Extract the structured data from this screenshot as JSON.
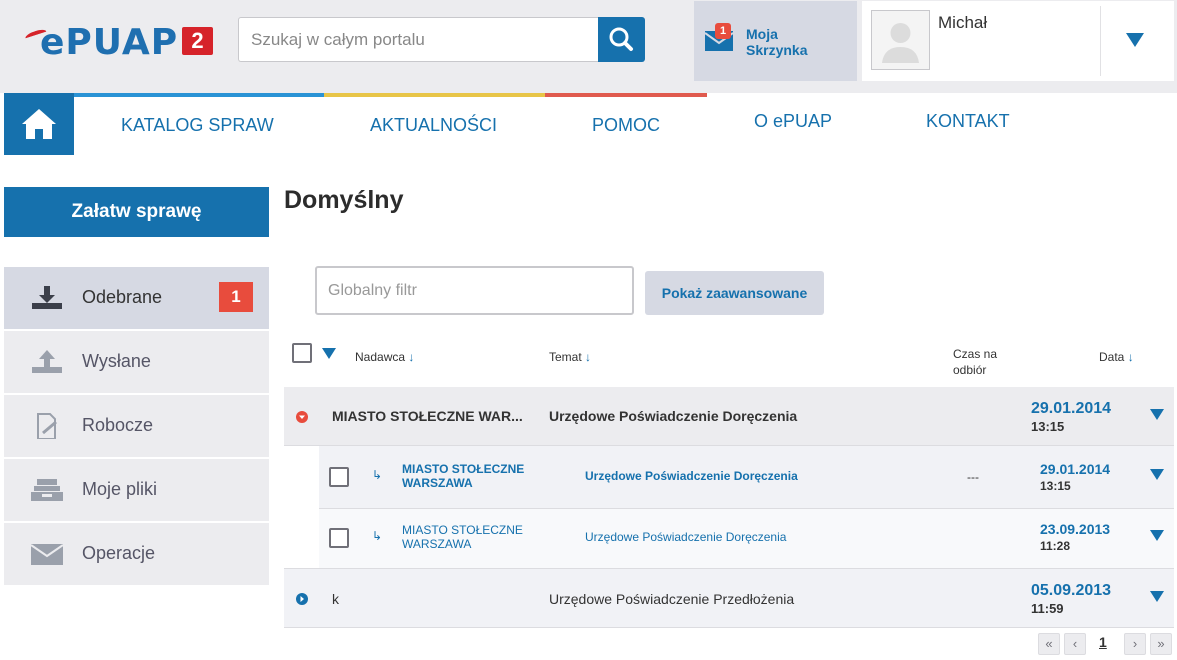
{
  "logo": {
    "text": "ePUAP",
    "badge": "2"
  },
  "search": {
    "placeholder": "Szukaj w całym portalu"
  },
  "inbox": {
    "badge": "1",
    "line1": "Moja",
    "line2": "Skrzynka"
  },
  "user": {
    "name": "Michał"
  },
  "nav": {
    "items": [
      "KATALOG SPRAW",
      "AKTUALNOŚCI",
      "POMOC",
      "O ePUAP",
      "KONTAKT"
    ],
    "line_colors": [
      "#2a93d5",
      "#e8c548",
      "#e05a4e"
    ]
  },
  "sidebar": {
    "primary_button": "Załatw sprawę",
    "items": [
      {
        "label": "Odebrane",
        "count": "1",
        "icon": "inbox-download-icon"
      },
      {
        "label": "Wysłane",
        "icon": "upload-icon"
      },
      {
        "label": "Robocze",
        "icon": "draft-edit-icon"
      },
      {
        "label": "Moje pliki",
        "icon": "files-tray-icon"
      },
      {
        "label": "Operacje",
        "icon": "envelope-icon"
      }
    ]
  },
  "main": {
    "title": "Domyślny",
    "filter_placeholder": "Globalny filtr",
    "advanced_button": "Pokaż zaawansowane",
    "columns": {
      "sender": "Nadawca",
      "subject": "Temat",
      "pickup_line1": "Czas na",
      "pickup_line2": "odbiór",
      "date": "Data",
      "sort_arrow": "↓"
    },
    "groups": [
      {
        "sender": "MIASTO STOŁECZNE WAR...",
        "subject": "Urzędowe Poświadczenie Doręczenia",
        "date": "29.01.2014",
        "time": "13:15",
        "expanded": true,
        "children": [
          {
            "sender_line1": "MIASTO STOŁECZNE",
            "sender_line2": "WARSZAWA",
            "subject": "Urzędowe Poświadczenie Doręczenia",
            "pickup": "---",
            "date": "29.01.2014",
            "time": "13:15",
            "unread": true
          },
          {
            "sender_line1": "MIASTO STOŁECZNE",
            "sender_line2": "WARSZAWA",
            "subject": "Urzędowe Poświadczenie Doręczenia",
            "pickup": "",
            "date": "23.09.2013",
            "time": "11:28",
            "unread": false
          }
        ]
      },
      {
        "sender": "k",
        "subject": "Urzędowe Poświadczenie Przedłożenia",
        "date": "05.09.2013",
        "time": "11:59",
        "expanded": false
      }
    ]
  },
  "pager": {
    "first": "«",
    "prev": "‹",
    "page": "1",
    "next": "›",
    "last": "»"
  },
  "colors": {
    "brand_blue": "#1671ad",
    "badge_red": "#e84c3d",
    "logo_red": "#d6232a"
  }
}
